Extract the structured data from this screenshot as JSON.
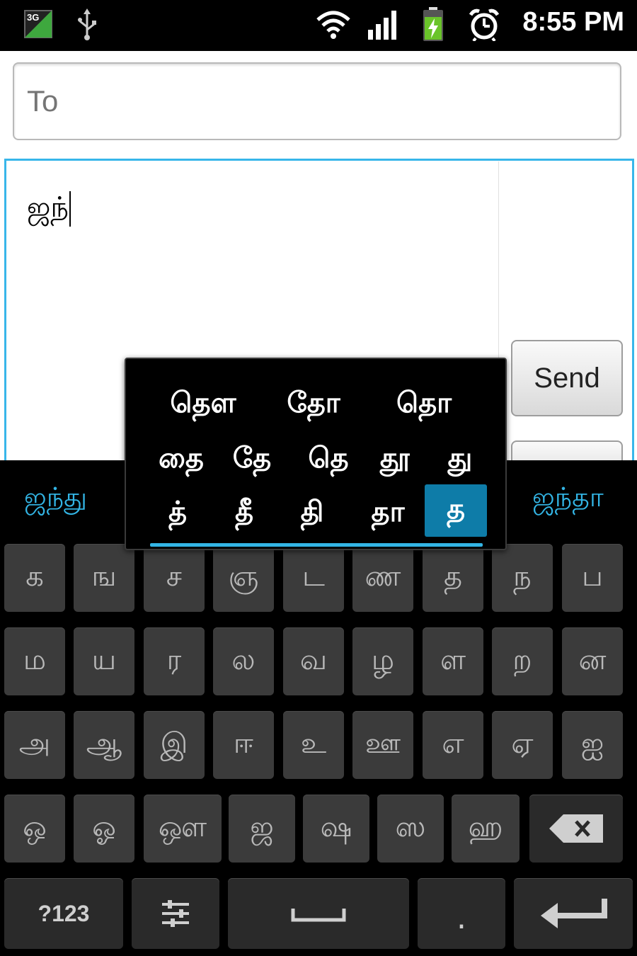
{
  "status_bar": {
    "network_label": "3G",
    "time": "8:55 PM",
    "icons": [
      "3g-data-icon",
      "usb-icon",
      "wifi-icon",
      "signal-icon",
      "battery-charging-icon",
      "alarm-icon"
    ]
  },
  "compose": {
    "to_placeholder": "To",
    "message_text": "ஜந்",
    "send_label": "Send"
  },
  "suggestions": {
    "left": "ஜந்து",
    "right": "ஜந்தா"
  },
  "popup": {
    "row1": [
      "தௌ",
      "தோ",
      "தொ"
    ],
    "row2": [
      "தை",
      "தே",
      "தெ",
      "தூ",
      "து"
    ],
    "row3": [
      "த்",
      "தீ",
      "தி",
      "தா",
      "த"
    ],
    "selected": "த"
  },
  "keyboard": {
    "row1": [
      "க",
      "ங",
      "ச",
      "ஞ",
      "ட",
      "ண",
      "த",
      "ந",
      "ப"
    ],
    "row2": [
      "ம",
      "ய",
      "ர",
      "ல",
      "வ",
      "ழ",
      "ள",
      "ற",
      "ன"
    ],
    "row3": [
      "அ",
      "ஆ",
      "இ",
      "ஈ",
      "உ",
      "ஊ",
      "எ",
      "ஏ",
      "ஐ"
    ],
    "row4": [
      "ஒ",
      "ஓ",
      "ஔ",
      "ஜ",
      "ஷ",
      "ஸ",
      "ஹ"
    ],
    "symbols_label": "?123",
    "period_label": "."
  },
  "colors": {
    "accent": "#33b5e5",
    "popup_selected": "#0e7ca8",
    "key_bg": "#3b3b3b"
  }
}
